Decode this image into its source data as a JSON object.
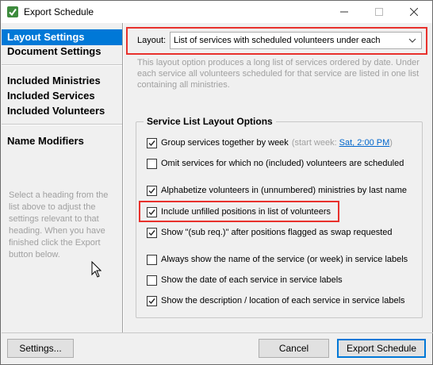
{
  "window": {
    "title": "Export Schedule"
  },
  "sidebar": {
    "items": [
      {
        "label": "Layout Settings",
        "selected": true
      },
      {
        "label": "Document Settings"
      },
      {
        "label": "Included Ministries"
      },
      {
        "label": "Included Services"
      },
      {
        "label": "Included Volunteers"
      },
      {
        "label": "Name Modifiers"
      }
    ],
    "help_text": "Select a heading from the list above to adjust the settings relevant to that heading. When you have finished click the Export button below."
  },
  "layout": {
    "label": "Layout:",
    "selected_value": "List of services with scheduled volunteers under each",
    "description": "This layout option produces a long list of services ordered by date. Under each service all volunteers scheduled for that service are listed in one list containing all ministries."
  },
  "service_options": {
    "title": "Service List Layout Options",
    "options": [
      {
        "label": "Group services together by week",
        "checked": true
      },
      {
        "label": "Omit services for which no (included) volunteers are scheduled",
        "checked": false
      },
      {
        "label": "Alphabetize volunteers in (unnumbered) ministries by last name",
        "checked": true
      },
      {
        "label": "Include unfilled positions in list of volunteers",
        "checked": true
      },
      {
        "label": "Show \"(sub req.)\" after positions flagged as swap requested",
        "checked": true
      },
      {
        "label": "Always show the name of the service (or week) in service labels",
        "checked": false
      },
      {
        "label": "Show the date of each service in service labels",
        "checked": false
      },
      {
        "label": "Show the description / location of each service in service labels",
        "checked": true
      }
    ],
    "start_week_prefix": "(start week:",
    "start_week_value": "Sat, 2:00 PM",
    "start_week_suffix": ")"
  },
  "buttons": {
    "settings": "Settings...",
    "cancel": "Cancel",
    "export": "Export Schedule"
  },
  "colors": {
    "accent": "#0078d7",
    "highlight": "#e8312c"
  }
}
